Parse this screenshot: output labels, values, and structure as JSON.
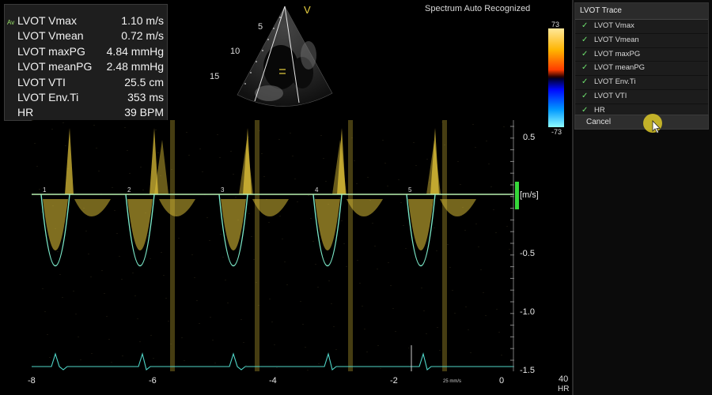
{
  "measurements": {
    "badge": "Av",
    "rows": [
      {
        "label": "LVOT Vmax",
        "value": "1.10 m/s"
      },
      {
        "label": "LVOT Vmean",
        "value": "0.72 m/s"
      },
      {
        "label": "LVOT maxPG",
        "value": "4.84 mmHg"
      },
      {
        "label": "LVOT meanPG",
        "value": "2.48 mmHg"
      },
      {
        "label": "LVOT VTI",
        "value": "25.5 cm"
      },
      {
        "label": "LVOT Env.Ti",
        "value": "353 ms"
      },
      {
        "label": "HR",
        "value": "39 BPM"
      }
    ]
  },
  "status": "Spectrum Auto Recognized",
  "sector": {
    "marker": "V",
    "depths": [
      "5",
      "10",
      "15"
    ]
  },
  "color_bar": {
    "top": "73",
    "bottom": "-73"
  },
  "trace_menu": {
    "title": "LVOT Trace",
    "items": [
      "LVOT Vmax",
      "LVOT Vmean",
      "LVOT maxPG",
      "LVOT meanPG",
      "LVOT Env.Ti",
      "LVOT VTI",
      "HR"
    ],
    "cancel_label": "Cancel"
  },
  "spectrum": {
    "velocity_ticks": [
      "0.5",
      "-0.5",
      "-1.0",
      "-1.5"
    ],
    "unit": "[m/s]",
    "time_ticks": [
      "-8",
      "-6",
      "-4",
      "-2",
      "0"
    ],
    "beat_labels": [
      "1",
      "2",
      "3",
      "4",
      "5"
    ],
    "sweep_speed": "25 mm/s"
  },
  "heart_rate": {
    "value": "40",
    "label": "HR"
  },
  "colors": {
    "trace": "#7be8c8",
    "doppler": "#e8c93a",
    "baseline": "#b8f0b0",
    "ecg": "#4fd6c8"
  }
}
